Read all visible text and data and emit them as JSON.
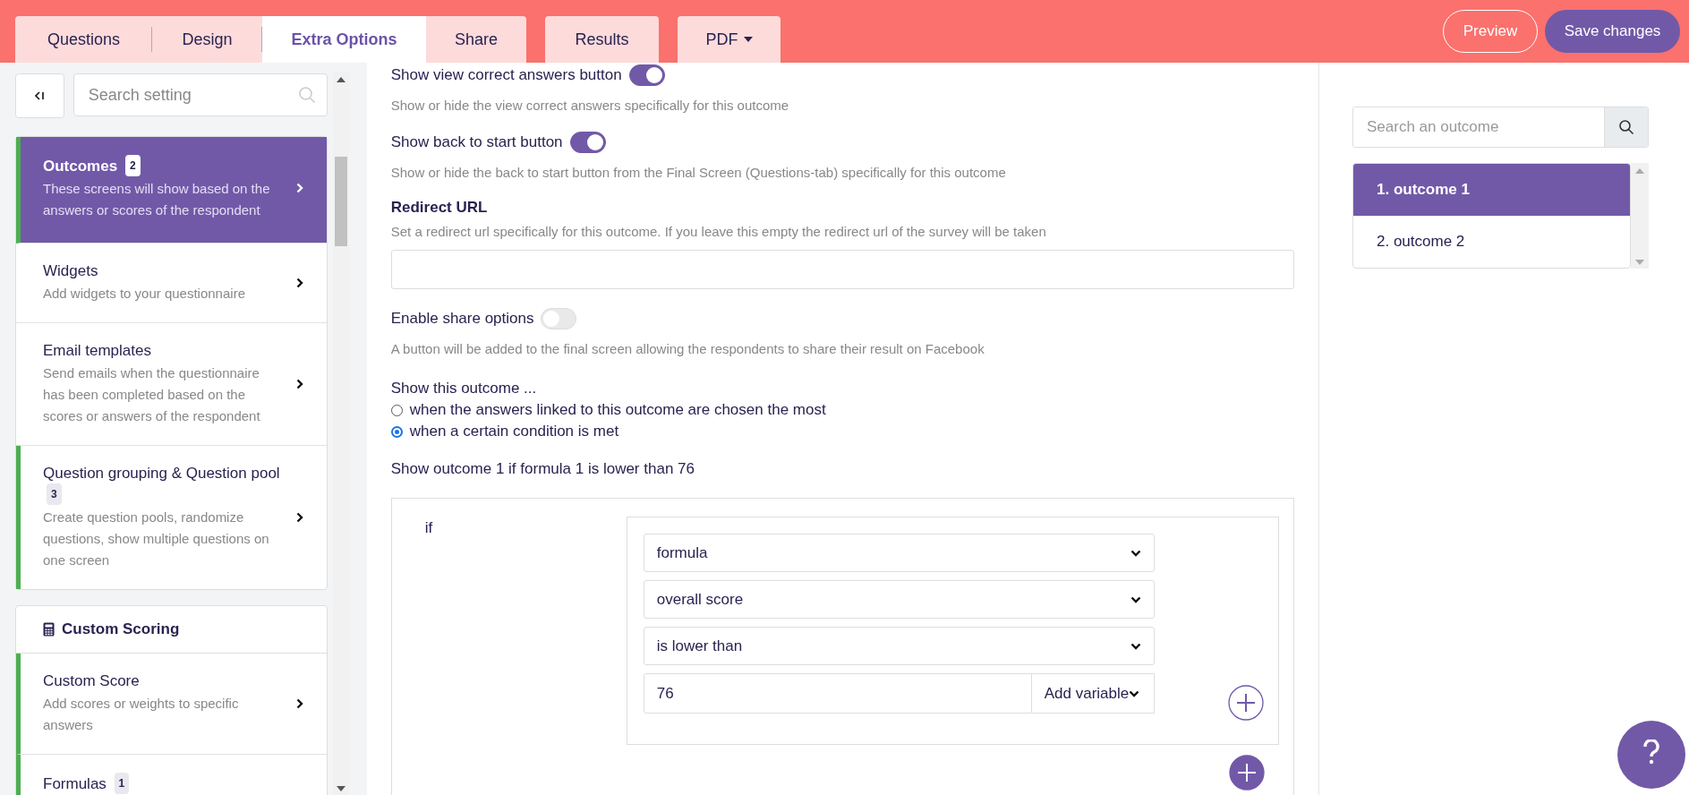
{
  "header": {
    "tabs": [
      {
        "label": "Questions",
        "selected": false,
        "kind": "plain"
      },
      {
        "label": "Design",
        "selected": false,
        "kind": "plain"
      },
      {
        "label": "Extra Options",
        "selected": true,
        "kind": "plain"
      },
      {
        "label": "Share",
        "selected": false,
        "kind": "plain"
      },
      {
        "label": "Results",
        "selected": false,
        "kind": "plain"
      },
      {
        "label": "PDF",
        "selected": false,
        "kind": "dropdown"
      }
    ],
    "actions": [
      {
        "label": "Preview",
        "kind": "outline"
      },
      {
        "label": "Save changes",
        "kind": "filled"
      }
    ]
  },
  "sidebar": {
    "search": {
      "placeholder": "Search setting"
    },
    "groups": [
      {
        "items": [
          {
            "title": "Outcomes",
            "badge": "2",
            "description": "These screens will show based on the answers or scores of the respondent",
            "selected": true,
            "enabled": true
          },
          {
            "title": "Widgets",
            "description": "Add widgets to your questionnaire",
            "selected": false,
            "enabled": false
          },
          {
            "title": "Email templates",
            "description": "Send emails when the questionnaire has been completed based on the scores or answers of the respondent",
            "selected": false,
            "enabled": false
          },
          {
            "title": "Question grouping & Question pool",
            "badge": "3",
            "description": "Create question pools, randomize questions, show multiple questions on one screen",
            "selected": false,
            "enabled": true
          }
        ]
      },
      {
        "title": "Custom Scoring",
        "items": [
          {
            "title": "Custom Score",
            "description": "Add scores or weights to specific answers",
            "selected": false,
            "enabled": true
          },
          {
            "title": "Formulas",
            "badge": "1",
            "selected": false,
            "enabled": true
          }
        ]
      }
    ]
  },
  "settings": [
    {
      "kind": "toggle",
      "label": "Show view correct answers button",
      "on": true,
      "description": "Show or hide the view correct answers specifically for this outcome"
    },
    {
      "kind": "toggle",
      "label": "Show back to start button",
      "on": true,
      "description": "Show or hide the back to start button from the Final Screen (Questions-tab) specifically for this outcome"
    },
    {
      "kind": "text",
      "label": "Redirect URL",
      "description": "Set a redirect url specifically for this outcome. If you leave this empty the redirect url of the survey will be taken"
    },
    {
      "kind": "toggle",
      "label": "Enable share options",
      "on": false,
      "description": "A button will be added to the final screen allowing the respondents to share their result on Facebook"
    }
  ],
  "show_outcome": {
    "label": "Show this outcome ...",
    "options": [
      {
        "label": "when the answers linked to this outcome are chosen the most",
        "selected": false
      },
      {
        "label": "when a certain condition is met",
        "selected": true
      }
    ]
  },
  "condition": {
    "summary": "Show outcome 1 if formula 1 is lower than 76",
    "if_label": "if",
    "selects": [
      "formula",
      "overall score",
      "is lower than"
    ],
    "value": "76",
    "variable_select": "Add variable"
  },
  "outcomes_panel": {
    "search": {
      "placeholder": "Search an outcome"
    },
    "items": [
      {
        "label": "1. outcome 1",
        "selected": true
      },
      {
        "label": "2. outcome 2",
        "selected": false
      }
    ]
  }
}
